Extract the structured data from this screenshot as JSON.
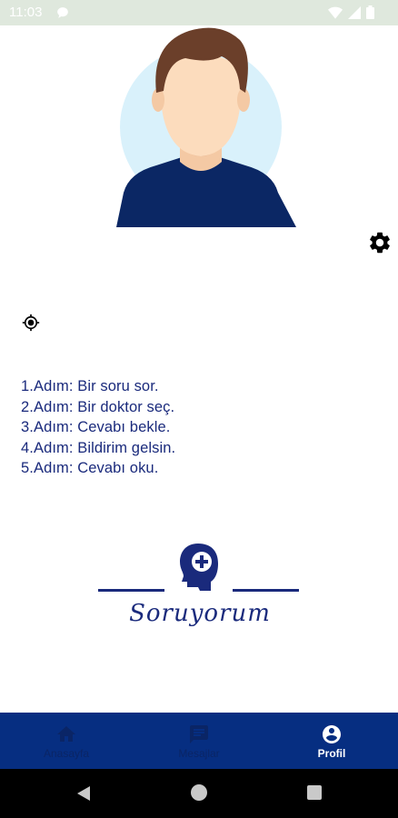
{
  "status_bar": {
    "time": "11:03",
    "icons": [
      "message-icon",
      "wifi-icon",
      "signal-icon",
      "battery-icon"
    ]
  },
  "profile": {
    "avatar_icon": "person-avatar-icon",
    "settings_icon": "gear-icon",
    "location_icon": "gps-target-icon"
  },
  "steps": [
    "1.Adım: Bir soru sor.",
    "2.Adım: Bir doktor seç.",
    "3.Adım: Cevabı bekle.",
    "4.Adım: Bildirim gelsin.",
    "5.Adım: Cevabı oku."
  ],
  "logo": {
    "text": "Soruyorum",
    "icon": "head-plus-icon"
  },
  "bottom_nav": {
    "items": [
      {
        "label": "Anasayfa",
        "icon": "home-icon",
        "active": false
      },
      {
        "label": "Mesajlar",
        "icon": "chat-icon",
        "active": false
      },
      {
        "label": "Profil",
        "icon": "account-circle-icon",
        "active": true
      }
    ]
  },
  "system_nav": {
    "icons": [
      "back-icon",
      "home-circle-icon",
      "recents-icon"
    ]
  },
  "colors": {
    "primary": "#062e81",
    "text": "#1a2a7c",
    "status_bar": "#dfe8dd",
    "avatar_bg": "#d9f1fb"
  }
}
